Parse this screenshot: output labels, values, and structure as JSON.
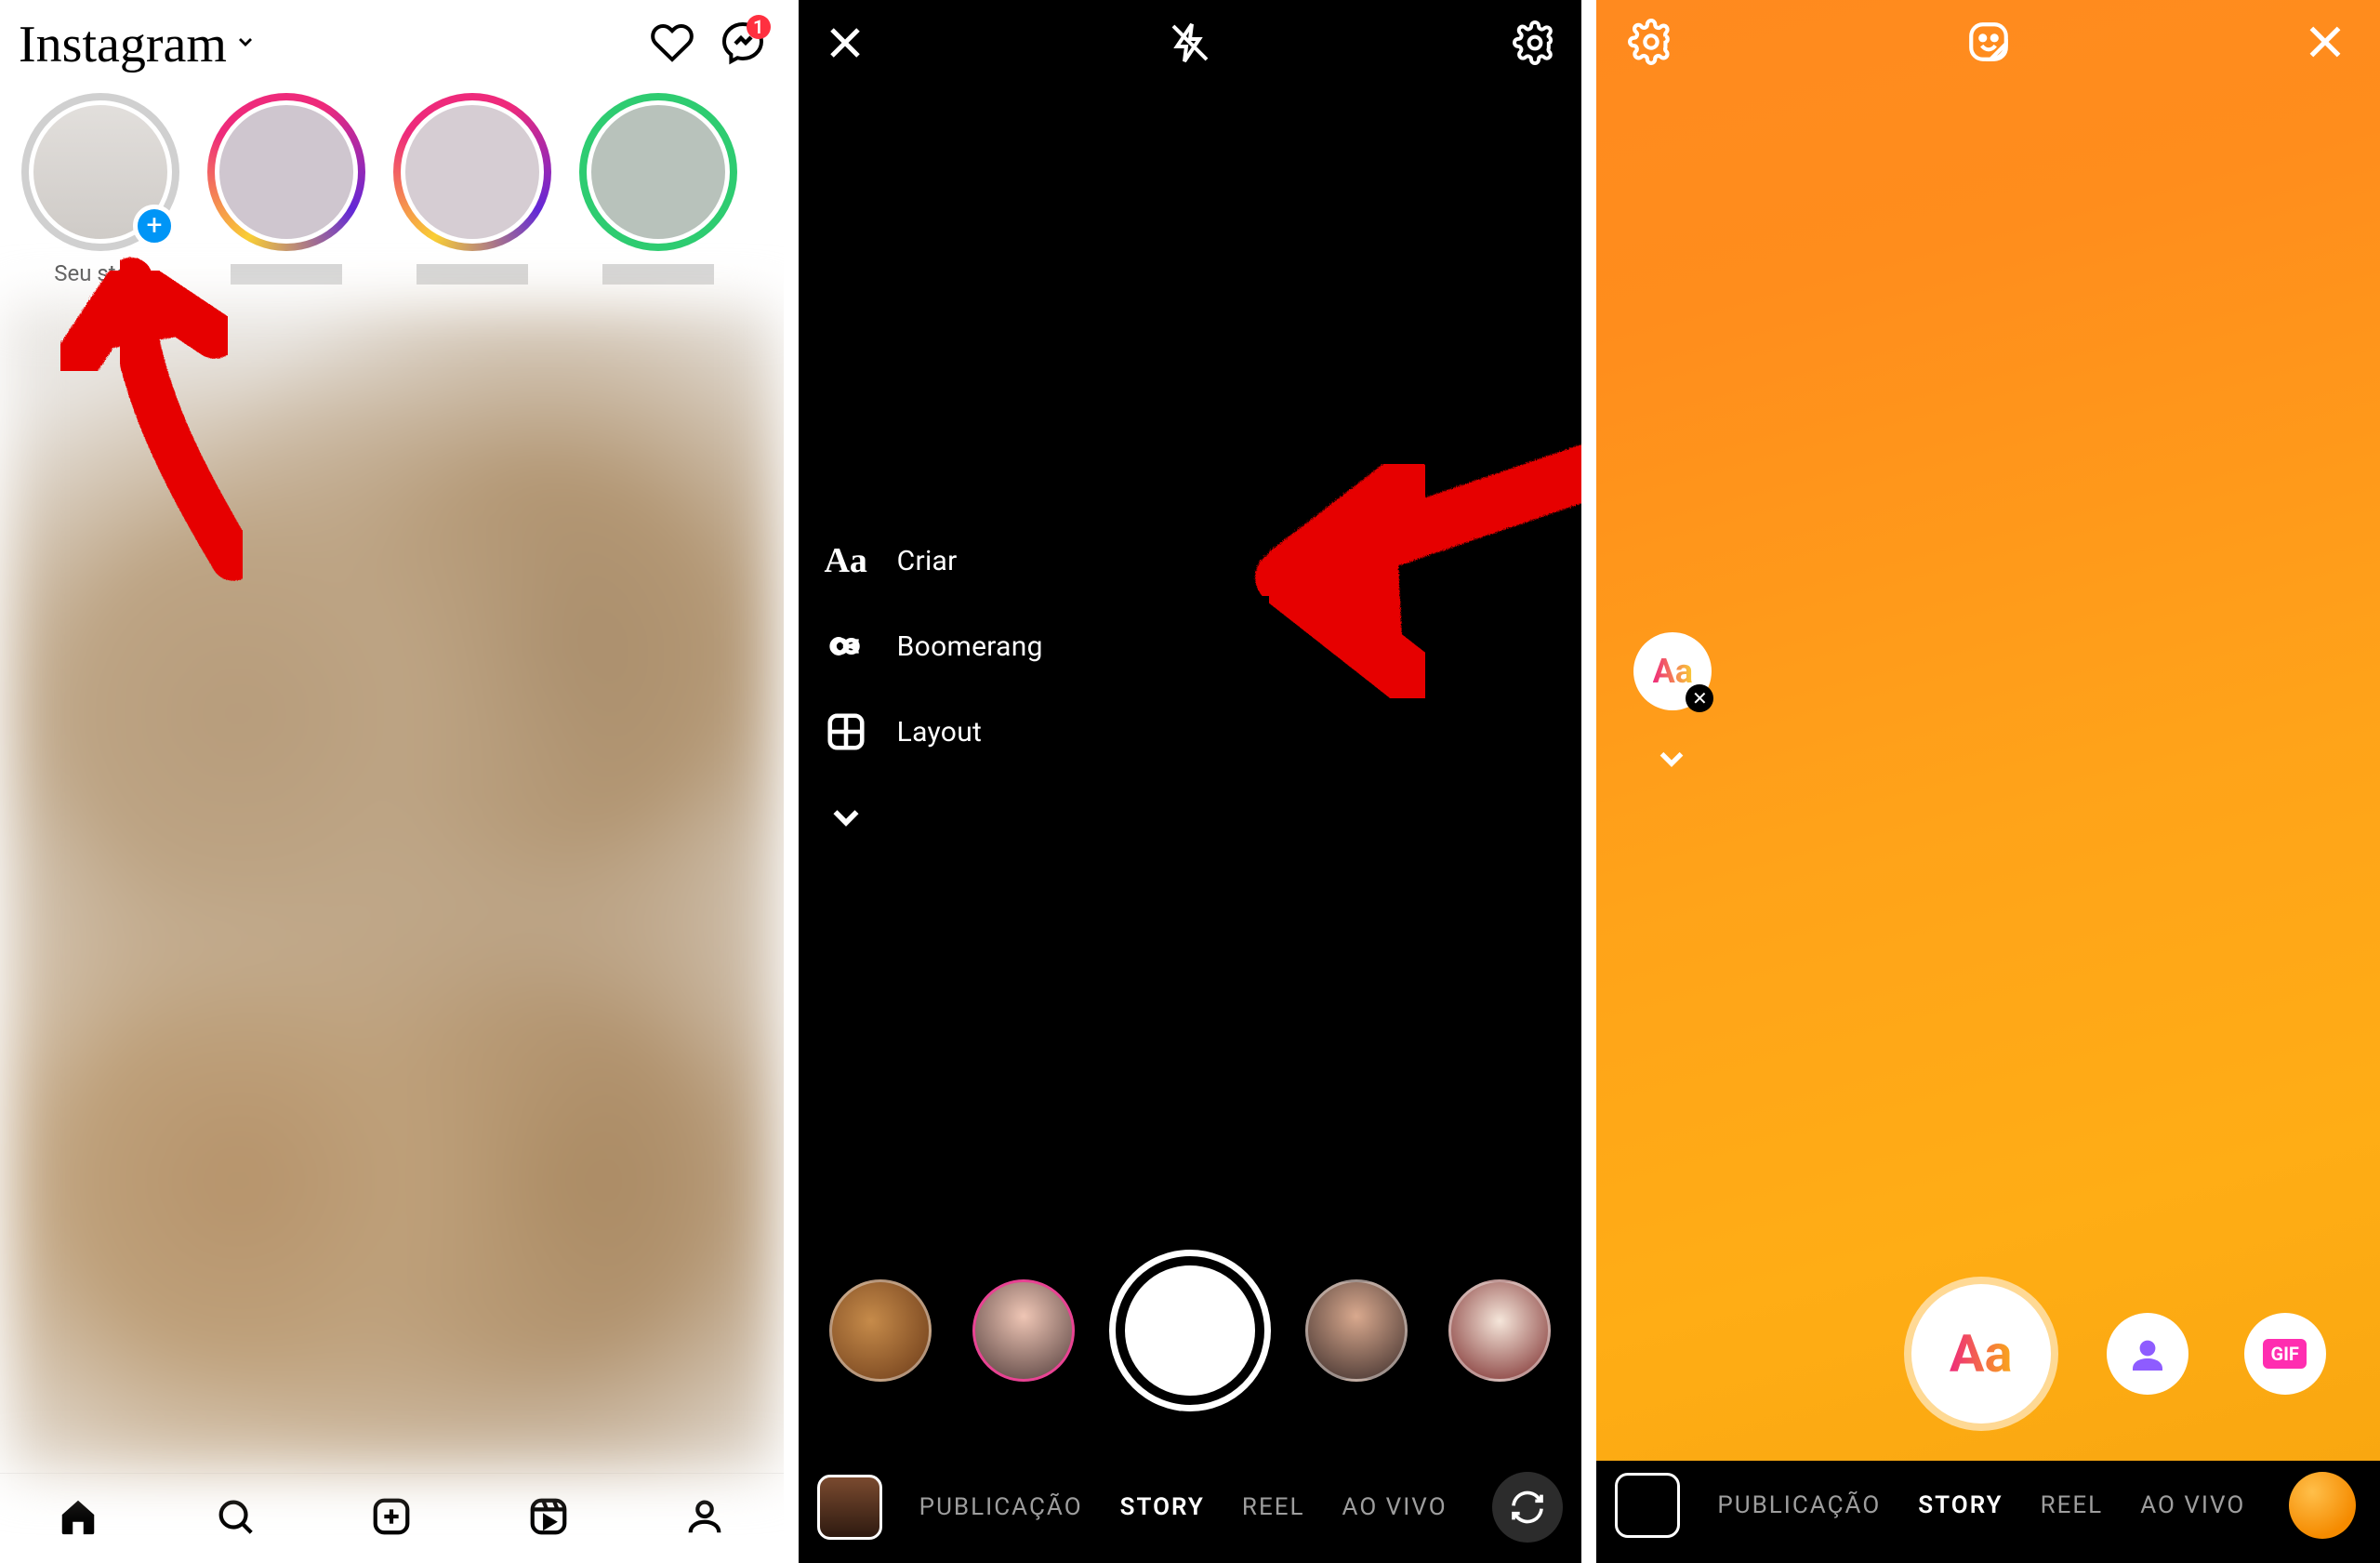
{
  "screen1": {
    "app_name": "Instagram",
    "messenger_badge": "1",
    "your_story_label": "Seu story",
    "nav": {
      "home": "home",
      "search": "search",
      "create": "create",
      "reels": "reels",
      "profile": "profile"
    }
  },
  "screen2": {
    "side_menu": {
      "create": "Criar",
      "boomerang": "Boomerang",
      "layout": "Layout"
    },
    "modes": {
      "post": "PUBLICAÇÃO",
      "story": "STORY",
      "reel": "REEL",
      "live": "AO VIVO"
    }
  },
  "screen3": {
    "aa_label": "Aa",
    "gif_label": "GIF",
    "modes": {
      "post": "PUBLICAÇÃO",
      "story": "STORY",
      "reel": "REEL",
      "live": "AO VIVO"
    }
  }
}
